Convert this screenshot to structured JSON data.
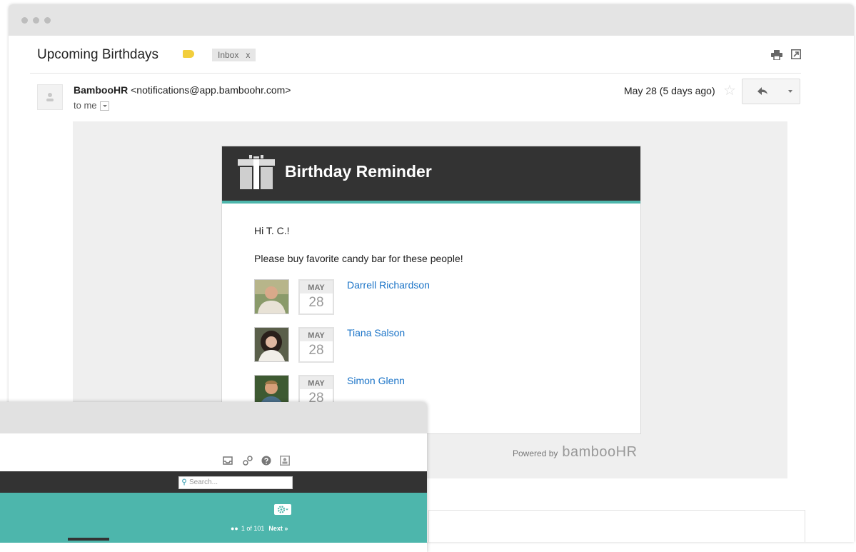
{
  "email": {
    "subject": "Upcoming Birthdays",
    "label": "Inbox",
    "label_close": "x",
    "sender_name": "BambooHR",
    "sender_email": "<notifications@app.bamboohr.com>",
    "to": "to me",
    "date": "May 28 (5 days ago)",
    "star": "☆"
  },
  "card": {
    "title": "Birthday Reminder",
    "greeting": "Hi T. C.!",
    "message": "Please buy favorite candy bar for these people!",
    "people": [
      {
        "name": "Darrell Richardson",
        "month": "MAY",
        "day": "28"
      },
      {
        "name": "Tiana Salson",
        "month": "MAY",
        "day": "28"
      },
      {
        "name": "Simon Glenn",
        "month": "MAY",
        "day": "28"
      }
    ],
    "powered_by": "Powered by",
    "logo": "bambooHR"
  },
  "app": {
    "search_placeholder": "Search...",
    "pager_count": "1 of 101",
    "pager_next": "Next »"
  },
  "colors": {
    "accent_teal": "#4db6ac",
    "dark_header": "#333333",
    "link_blue": "#1a73c7",
    "label_yellow": "#f2ce3c"
  }
}
